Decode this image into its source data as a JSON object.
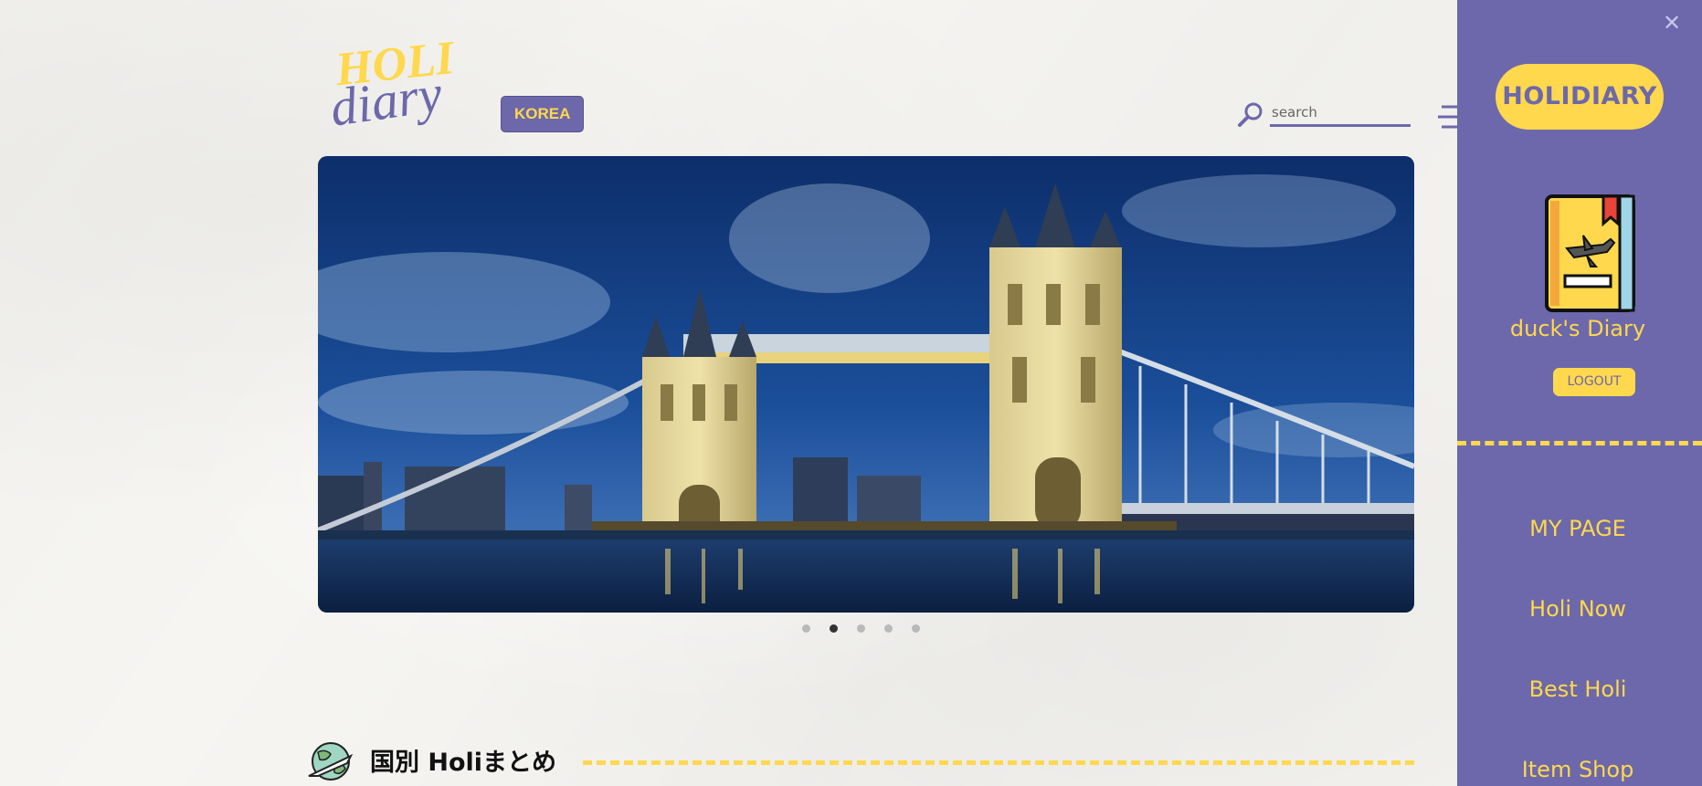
{
  "header": {
    "logo_top": "HOLI",
    "logo_bottom": "diary",
    "country_label": "KOREA",
    "search_placeholder": "search"
  },
  "carousel": {
    "image_subject": "tower-bridge-london-at-dusk",
    "slide_count": 5,
    "active_slide": 2
  },
  "section": {
    "title": "国別 Holiまとめ"
  },
  "side_panel": {
    "brand": "HOLIDIARY",
    "user_name": "duck's Diary",
    "logout_label": "LOGOUT",
    "menu": [
      {
        "label": "MY PAGE"
      },
      {
        "label": "Holi Now"
      },
      {
        "label": "Best Holi"
      },
      {
        "label": "Item Shop"
      }
    ]
  },
  "colors": {
    "accent_purple": "#6c68ab",
    "accent_yellow": "#ffd84d"
  }
}
